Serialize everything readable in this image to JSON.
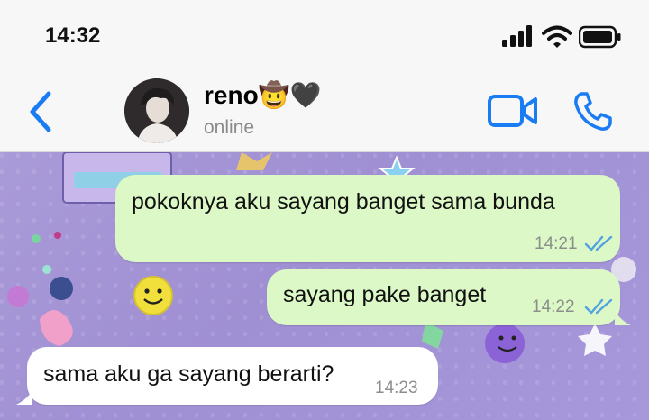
{
  "status_bar": {
    "time": "14:32",
    "icons": [
      "signal-icon",
      "wifi-icon",
      "battery-icon"
    ]
  },
  "header": {
    "back_icon": "chevron-left-icon",
    "contact_name": "reno🤠🖤",
    "contact_status": "online",
    "actions": [
      "video-call-icon",
      "phone-icon"
    ]
  },
  "messages": [
    {
      "direction": "outgoing",
      "text": "pokoknya aku sayang banget sama bunda",
      "time": "14:21",
      "status": "read"
    },
    {
      "direction": "outgoing",
      "text": "sayang pake banget",
      "time": "14:22",
      "status": "read"
    },
    {
      "direction": "incoming",
      "text": "sama aku ga sayang berarti?",
      "time": "14:23"
    }
  ],
  "colors": {
    "accent": "#1a7cf2",
    "outgoing_bubble": "#dcf8c6",
    "incoming_bubble": "#ffffff",
    "read_ticks": "#4fa3e0",
    "chat_background": "#a597da"
  }
}
